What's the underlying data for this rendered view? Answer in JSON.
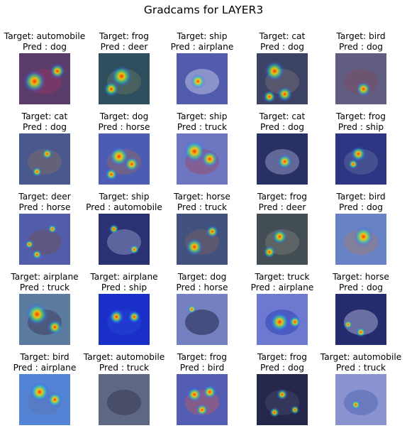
{
  "title": "Gradcams for LAYER3",
  "cells": [
    {
      "target": "Target: automobile",
      "pred": "Pred : dog",
      "bg": "#7a3a52",
      "obj": "#c0304a",
      "cool": "#34408a",
      "hot": [
        [
          0.3,
          0.55,
          0.45
        ],
        [
          0.75,
          0.35,
          0.3
        ]
      ]
    },
    {
      "target": "Target: frog",
      "pred": "Pred : deer",
      "bg": "#2f5a46",
      "obj": "#6b8a4a",
      "cool": "#30407c",
      "hot": [
        [
          0.45,
          0.45,
          0.42
        ],
        [
          0.25,
          0.7,
          0.3
        ]
      ]
    },
    {
      "target": "Target: ship",
      "pred": "Pred : airplane",
      "bg": "#4a56a8",
      "obj": "#d9dcef",
      "cool": "#5a64b4",
      "hot": [
        [
          0.42,
          0.55,
          0.3
        ]
      ]
    },
    {
      "target": "Target: cat",
      "pred": "Pred : dog",
      "bg": "#4a4a38",
      "obj": "#8a7a48",
      "cool": "#2d3aa0",
      "hot": [
        [
          0.35,
          0.35,
          0.4
        ],
        [
          0.55,
          0.8,
          0.3
        ],
        [
          0.25,
          0.85,
          0.25
        ]
      ]
    },
    {
      "target": "Target: bird",
      "pred": "Pred : dog",
      "bg": "#6a5a78",
      "obj": "#8a4a50",
      "cool": "#54608e",
      "hot": [
        [
          0.55,
          0.7,
          0.3
        ]
      ]
    },
    {
      "target": "Target: cat",
      "pred": "Pred : dog",
      "bg": "#4a5a86",
      "obj": "#8a7050",
      "cool": "#4a5898",
      "hot": [
        [
          0.55,
          0.4,
          0.22
        ],
        [
          0.35,
          0.75,
          0.2
        ]
      ]
    },
    {
      "target": "Target: dog",
      "pred": "Pred : horse",
      "bg": "#5a68b8",
      "obj": "#b07a50",
      "cool": "#3c4cb0",
      "hot": [
        [
          0.4,
          0.45,
          0.4
        ],
        [
          0.65,
          0.6,
          0.3
        ],
        [
          0.25,
          0.8,
          0.25
        ]
      ]
    },
    {
      "target": "Target: ship",
      "pred": "Pred : truck",
      "bg": "#8a90c8",
      "obj": "#c05a5a",
      "cool": "#4a58b8",
      "hot": [
        [
          0.35,
          0.35,
          0.45
        ],
        [
          0.65,
          0.5,
          0.35
        ]
      ]
    },
    {
      "target": "Target: cat",
      "pred": "Pred : dog",
      "bg": "#28305a",
      "obj": "#b0b8d8",
      "cool": "#2a3070",
      "hot": [
        [
          0.55,
          0.55,
          0.3
        ]
      ]
    },
    {
      "target": "Target: frog",
      "pred": "Pred : ship",
      "bg": "#303a80",
      "obj": "#6a7aa0",
      "cool": "#2a3488",
      "hot": [
        [
          0.45,
          0.4,
          0.3
        ],
        [
          0.35,
          0.6,
          0.2
        ]
      ]
    },
    {
      "target": "Target: deer",
      "pred": "Pred : horse",
      "bg": "#5a62a8",
      "obj": "#7a5048",
      "cool": "#4a58b0",
      "hot": [
        [
          0.65,
          0.3,
          0.18
        ],
        [
          0.2,
          0.6,
          0.18
        ],
        [
          0.35,
          0.8,
          0.2
        ]
      ]
    },
    {
      "target": "Target: ship",
      "pred": "Pred : automobile",
      "bg": "#2a3270",
      "obj": "#a8acd8",
      "cool": "#2a3478",
      "hot": [
        [
          0.3,
          0.3,
          0.2
        ],
        [
          0.7,
          0.7,
          0.2
        ]
      ]
    },
    {
      "target": "Target: horse",
      "pred": "Pred : truck",
      "bg": "#4a5a70",
      "obj": "#8a6a50",
      "cool": "#3a4a90",
      "hot": [
        [
          0.35,
          0.65,
          0.35
        ],
        [
          0.7,
          0.35,
          0.25
        ]
      ]
    },
    {
      "target": "Target: frog",
      "pred": "Pred : deer",
      "bg": "#4a5030",
      "obj": "#8a8a5a",
      "cool": "#3a4a80",
      "hot": [
        [
          0.45,
          0.45,
          0.3
        ],
        [
          0.25,
          0.75,
          0.25
        ]
      ]
    },
    {
      "target": "Target: bird",
      "pred": "Pred : dog",
      "bg": "#7a90c8",
      "obj": "#c08a6a",
      "cool": "#5070c0",
      "hot": [
        [
          0.55,
          0.45,
          0.4
        ]
      ]
    },
    {
      "target": "Target: airplane",
      "pred": "Pred : truck",
      "bg": "#6a8a98",
      "obj": "#4a3a40",
      "cool": "#4a68a8",
      "hot": [
        [
          0.35,
          0.4,
          0.45
        ],
        [
          0.7,
          0.65,
          0.3
        ]
      ]
    },
    {
      "target": "Target: airplane",
      "pred": "Pred : ship",
      "bg": "#1a30c8",
      "obj": "#2a48d8",
      "cool": "#1a2ec8",
      "hot": [
        [
          0.35,
          0.45,
          0.3
        ],
        [
          0.7,
          0.45,
          0.25
        ]
      ]
    },
    {
      "target": "Target: dog",
      "pred": "Pred : horse",
      "bg": "#8a92c8",
      "obj": "#1a1a2a",
      "cool": "#5a6ab8",
      "hot": [
        [
          0.3,
          0.3,
          0.18
        ]
      ]
    },
    {
      "target": "Target: truck",
      "pred": "Pred : airplane",
      "bg": "#8a90d8",
      "obj": "#3a4ab0",
      "cool": "#4a5ac8",
      "hot": [
        [
          0.45,
          0.55,
          0.4
        ],
        [
          0.75,
          0.55,
          0.25
        ]
      ]
    },
    {
      "target": "Target: horse",
      "pred": "Pred : dog",
      "bg": "#202860",
      "obj": "#c8c8d8",
      "cool": "#2a3080",
      "hot": [
        [
          0.5,
          0.75,
          0.2
        ],
        [
          0.25,
          0.6,
          0.18
        ]
      ]
    },
    {
      "target": "Target: bird",
      "pred": "Pred : airplane",
      "bg": "#5a8ad8",
      "obj": "#6a7ab0",
      "cool": "#4a7ad0",
      "hot": [
        [
          0.4,
          0.35,
          0.4
        ],
        [
          0.7,
          0.5,
          0.3
        ]
      ]
    },
    {
      "target": "Target: automobile",
      "pred": "Pred : truck",
      "bg": "#707890",
      "obj": "#3a3a48",
      "cool": "#4a5478",
      "hot": []
    },
    {
      "target": "Target: frog",
      "pred": "Pred : bird",
      "bg": "#5a62b0",
      "obj": "#d06050",
      "cool": "#4a58b8",
      "hot": [
        [
          0.35,
          0.4,
          0.3
        ],
        [
          0.65,
          0.35,
          0.28
        ],
        [
          0.5,
          0.7,
          0.25
        ]
      ]
    },
    {
      "target": "Target: frog",
      "pred": "Pred : dog",
      "bg": "#22243a",
      "obj": "#4a4a60",
      "cool": "#2a2c60",
      "hot": [
        [
          0.5,
          0.4,
          0.22
        ],
        [
          0.35,
          0.75,
          0.2
        ],
        [
          0.75,
          0.7,
          0.18
        ]
      ]
    },
    {
      "target": "Target: automobile",
      "pred": "Pred : truck",
      "bg": "#9aa0d8",
      "obj": "#4a6ab0",
      "cool": "#7a80c8",
      "hot": [
        [
          0.4,
          0.6,
          0.2
        ]
      ]
    }
  ]
}
